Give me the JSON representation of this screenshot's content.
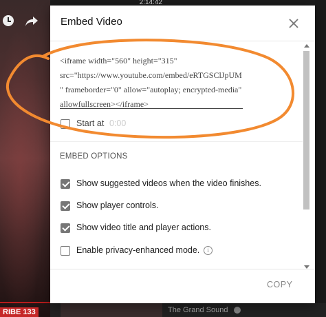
{
  "background": {
    "time_badge": "2:14:42",
    "bottom_left_label": "RIBE 133",
    "bottom_title": "The Grand Sound"
  },
  "dialog": {
    "title": "Embed Video",
    "embed_code": "<iframe width=\"560\" height=\"315\" src=\"https://www.youtube.com/embed/eRTGSClJpUM\" frameborder=\"0\" allow=\"autoplay; encrypted-media\" allowfullscreen></iframe>",
    "start_at_label": "Start at",
    "start_at_time": "0:00",
    "start_at_checked": false,
    "embed_options_title": "EMBED OPTIONS",
    "options": [
      {
        "label": "Show suggested videos when the video finishes.",
        "checked": true
      },
      {
        "label": "Show player controls.",
        "checked": true
      },
      {
        "label": "Show video title and player actions.",
        "checked": true
      },
      {
        "label": "Enable privacy-enhanced mode.",
        "checked": false,
        "info": "i"
      }
    ],
    "copy_label": "COPY"
  },
  "colors": {
    "annotation": "#f28a30",
    "checkbox_checked": "#767676",
    "dialog_bg": "#ffffff"
  },
  "icons": [
    "clock-icon",
    "share-icon",
    "close-icon",
    "info-icon",
    "scroll-up-arrow",
    "scroll-down-arrow"
  ]
}
